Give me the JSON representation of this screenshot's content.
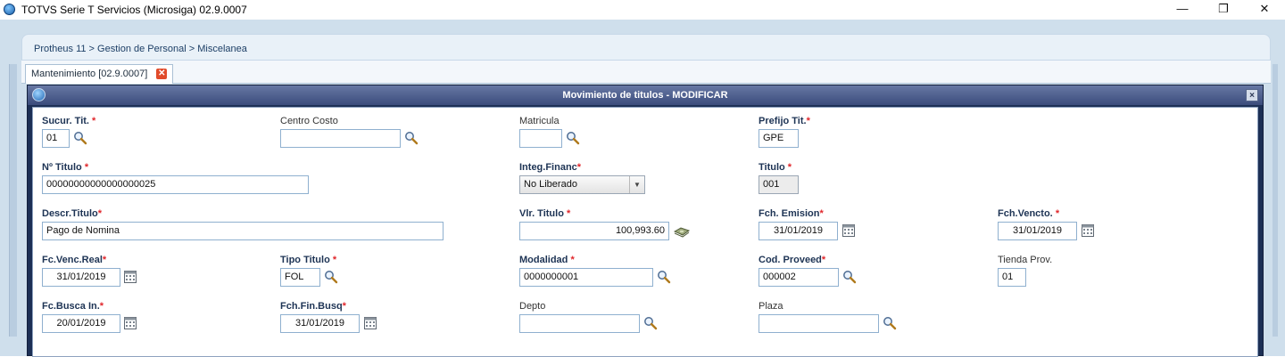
{
  "window": {
    "title": "TOTVS Serie T Servicios (Microsiga) 02.9.0007",
    "minimize": "—",
    "restore": "❐",
    "close": "✕"
  },
  "breadcrumb": "Protheus 11 > Gestion de Personal > Miscelanea",
  "tab": {
    "label": "Mantenimiento [02.9.0007]",
    "close": "✕"
  },
  "dialog": {
    "title": "Movimiento de titulos - MODIFICAR",
    "close": "×"
  },
  "fields": {
    "sucur_tit": {
      "label": "Sucur. Tit.",
      "value": "01",
      "required": true,
      "icon": "search-icon"
    },
    "centro_costo": {
      "label": "Centro Costo",
      "value": "",
      "icon": "search-icon"
    },
    "matricula": {
      "label": "Matricula",
      "value": "",
      "icon": "search-icon"
    },
    "prefijo_tit": {
      "label": "Prefijo Tit.",
      "value": "GPE",
      "required": true
    },
    "no_titulo": {
      "label": "Nº Titulo",
      "value": "00000000000000000025",
      "required": true
    },
    "integ_financ": {
      "label": "Integ.Financ",
      "value": "No Liberado",
      "required": true
    },
    "titulo": {
      "label": "Titulo",
      "value": "001",
      "required": true
    },
    "descr_titulo": {
      "label": "Descr.Titulo",
      "value": "Pago de Nomina",
      "required": true
    },
    "vlr_titulo": {
      "label": "Vlr. Titulo",
      "value": "100,993.60",
      "required": true,
      "icon": "money-icon"
    },
    "fch_emision": {
      "label": "Fch. Emision",
      "value": "31/01/2019",
      "required": true,
      "icon": "calendar-icon"
    },
    "fch_vencto": {
      "label": "Fch.Vencto.",
      "value": "31/01/2019",
      "required": true,
      "icon": "calendar-icon"
    },
    "fc_venc_real": {
      "label": "Fc.Venc.Real",
      "value": "31/01/2019",
      "required": true,
      "icon": "calendar-icon"
    },
    "tipo_titulo": {
      "label": "Tipo Titulo",
      "value": "FOL",
      "required": true,
      "icon": "search-icon"
    },
    "modalidad": {
      "label": "Modalidad",
      "value": "0000000001",
      "required": true,
      "icon": "search-icon"
    },
    "cod_proveed": {
      "label": "Cod. Proveed",
      "value": "000002",
      "required": true,
      "icon": "search-icon"
    },
    "tienda_prov": {
      "label": "Tienda Prov.",
      "value": "01"
    },
    "fc_busca_in": {
      "label": "Fc.Busca In.",
      "value": "20/01/2019",
      "required": true,
      "icon": "calendar-icon"
    },
    "fch_fin_busq": {
      "label": "Fch.Fin.Busq",
      "value": "31/01/2019",
      "required": true,
      "icon": "calendar-icon"
    },
    "depto": {
      "label": "Depto",
      "value": "",
      "icon": "search-icon"
    },
    "plaza": {
      "label": "Plaza",
      "value": "",
      "icon": "search-icon"
    }
  },
  "required_mark": "*",
  "colors": {
    "dialog_header": "#3b4c7c",
    "required": "#e0262b",
    "input_border": "#8fb0cf",
    "workarea": "#cfdfec"
  }
}
